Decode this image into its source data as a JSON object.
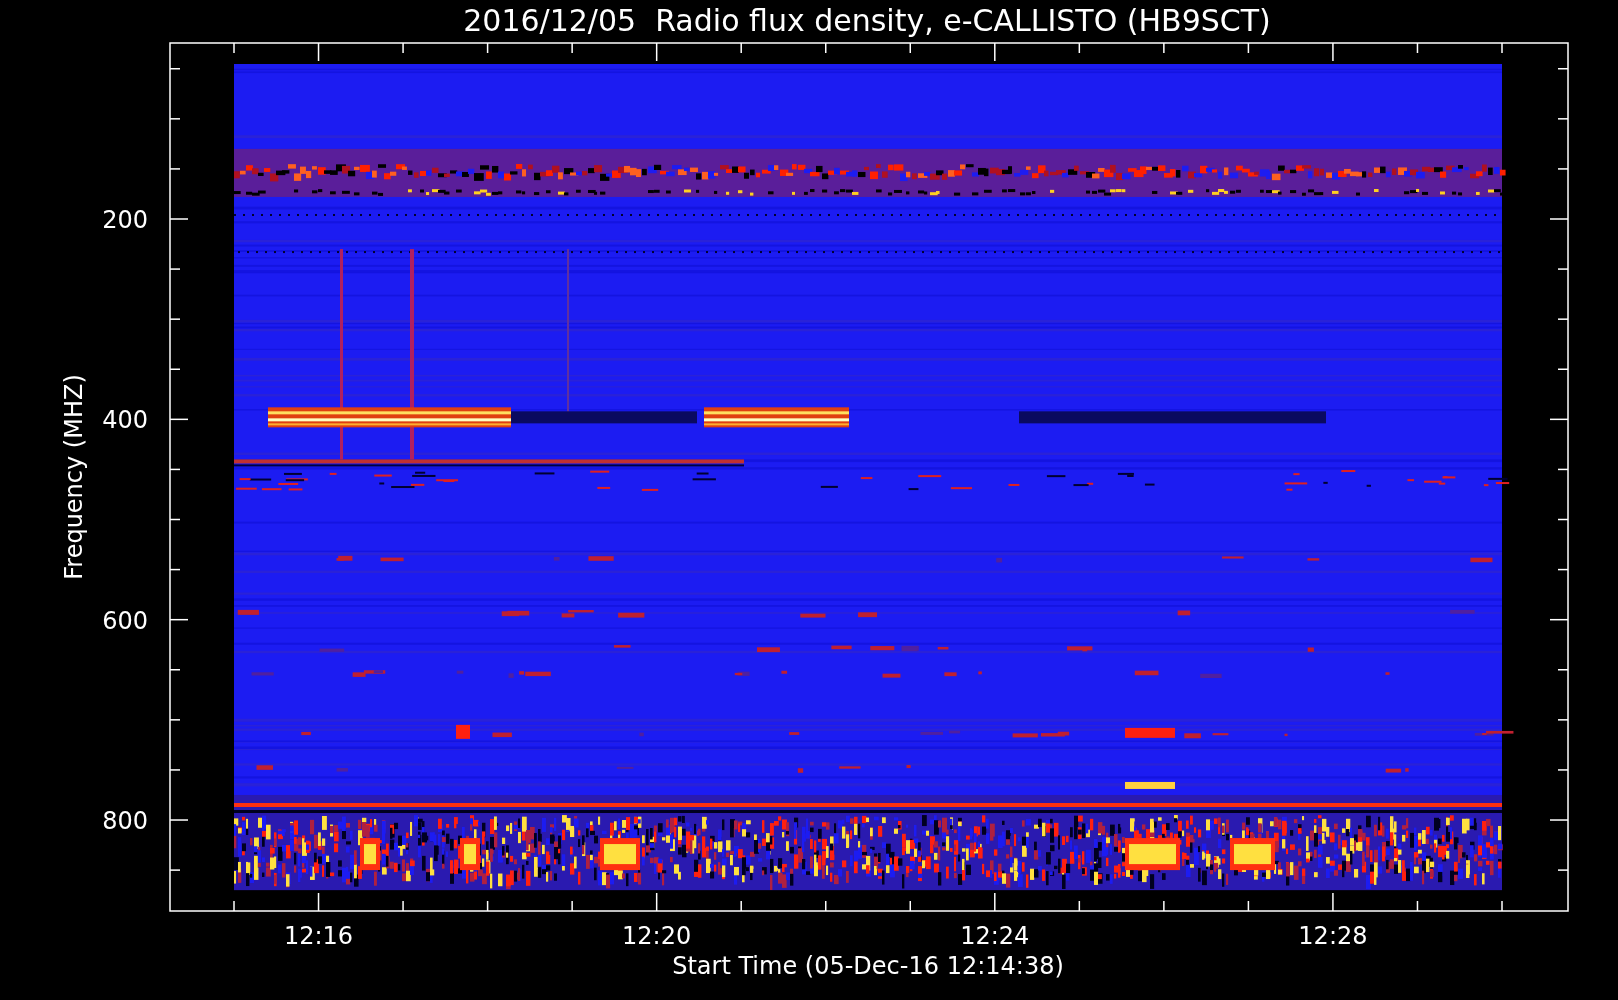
{
  "title": "2016/12/05  Radio flux density, e-CALLISTO (HB9SCT)",
  "y_axis": {
    "label": "Frequency (MHZ)",
    "ticks": [
      "200",
      "400",
      "600",
      "800"
    ]
  },
  "x_axis": {
    "label": "Start Time (05-Dec-16 12:14:38)",
    "ticks": [
      "12:16",
      "12:20",
      "12:24",
      "12:28"
    ]
  }
}
